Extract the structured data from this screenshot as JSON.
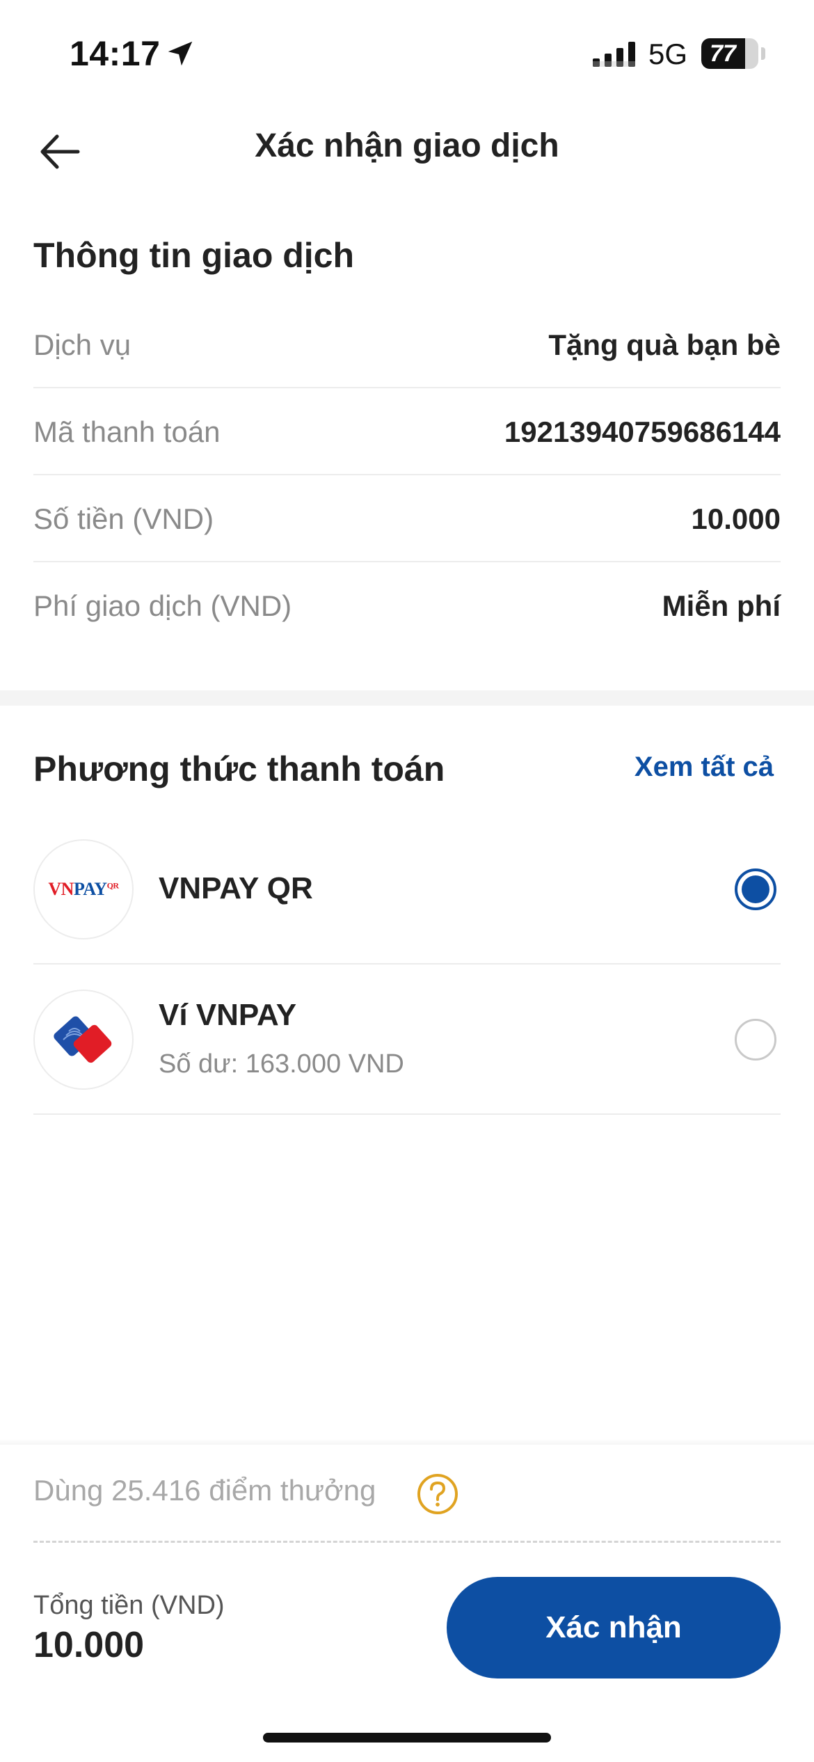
{
  "status_bar": {
    "time": "14:17",
    "network": "5G",
    "battery_percent": "77",
    "battery_level": 0.77,
    "icons": {
      "location": "location-arrow-icon",
      "signal": "signal-bars-icon",
      "battery": "battery-icon"
    }
  },
  "header": {
    "title": "Xác nhận giao dịch",
    "back_icon": "arrow-left-icon"
  },
  "transaction_info": {
    "title": "Thông tin giao dịch",
    "rows": [
      {
        "label": "Dịch vụ",
        "value": "Tặng quà bạn bè"
      },
      {
        "label": "Mã thanh toán",
        "value": "19213940759686144"
      },
      {
        "label": "Số tiền (VND)",
        "value": "10.000"
      },
      {
        "label": "Phí giao dịch (VND)",
        "value": "Miễn phí"
      }
    ]
  },
  "payment_methods": {
    "title": "Phương thức thanh toán",
    "see_all_label": "Xem tất cả",
    "methods": [
      {
        "name": "VNPAY QR",
        "subtitle": "",
        "selected": true,
        "logo": {
          "icon": "vnpay-qr-logo",
          "text_red": "VN",
          "text_blue": "PAY",
          "text_qr": "QR"
        }
      },
      {
        "name": "Ví VNPAY",
        "subtitle": "Số dư: 163.000 VND",
        "selected": false,
        "logo": {
          "icon": "vnpay-wallet-logo"
        }
      }
    ]
  },
  "rewards": {
    "text": "Dùng 25.416 điểm thưởng",
    "help_icon": "question-circle-icon"
  },
  "footer": {
    "total_label": "Tổng tiền (VND)",
    "total_value": "10.000",
    "confirm_label": "Xác nhận"
  },
  "colors": {
    "primary": "#0d4fa3",
    "brand_red": "#e11d26",
    "text": "#222222",
    "muted": "#8a8a8a",
    "help_icon": "#e0a321"
  }
}
